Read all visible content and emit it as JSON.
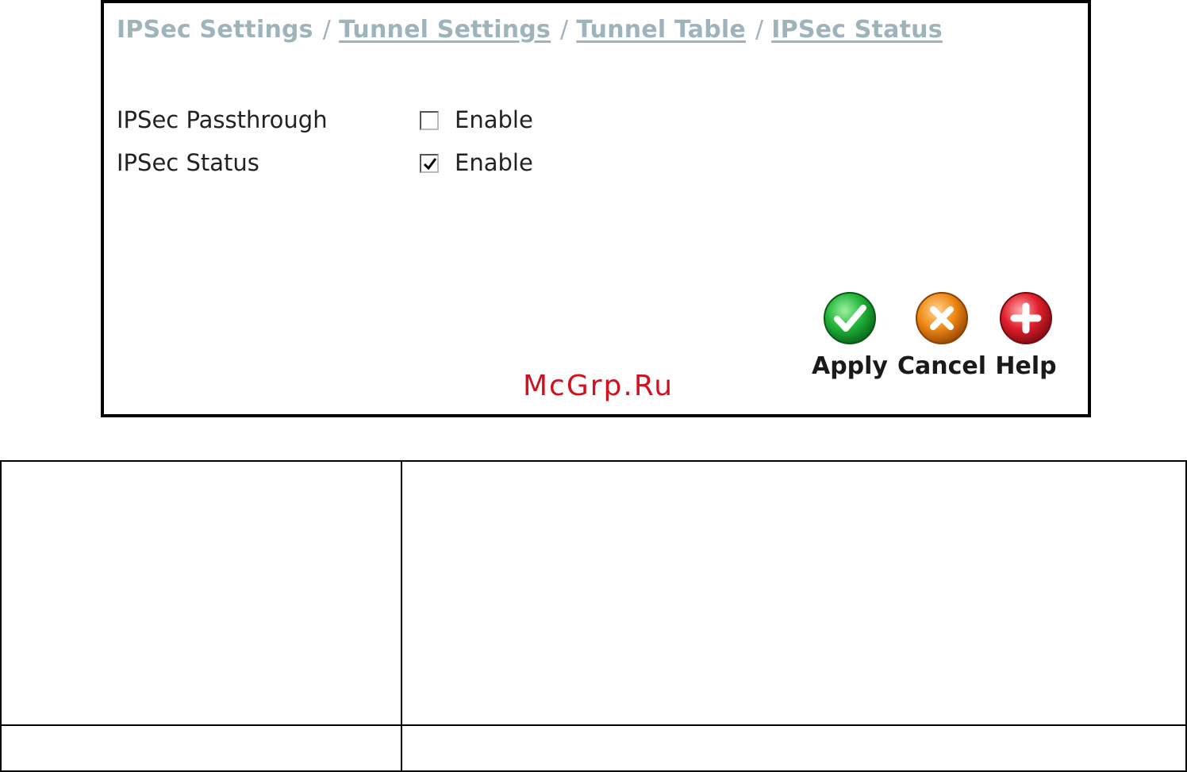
{
  "breadcrumb": {
    "items": [
      {
        "label": "IPSec Settings",
        "link": false
      },
      {
        "label": "Tunnel Settings",
        "link": true
      },
      {
        "label": "Tunnel Table",
        "link": true
      },
      {
        "label": "IPSec Status",
        "link": true
      }
    ],
    "separator": "/"
  },
  "settings": {
    "passthrough": {
      "label": "IPSec Passthrough",
      "option": "Enable",
      "checked": false
    },
    "status": {
      "label": "IPSec Status",
      "option": "Enable",
      "checked": true
    }
  },
  "actions": {
    "apply": {
      "label": "Apply",
      "color": "#1db33a"
    },
    "cancel": {
      "label": "Cancel",
      "color": "#f08a16"
    },
    "help": {
      "label": "Help",
      "color": "#e0202c"
    }
  },
  "watermark": "McGrp.Ru",
  "colors": {
    "breadcrumb": "#9fb3bb",
    "watermark": "#d4101f"
  }
}
